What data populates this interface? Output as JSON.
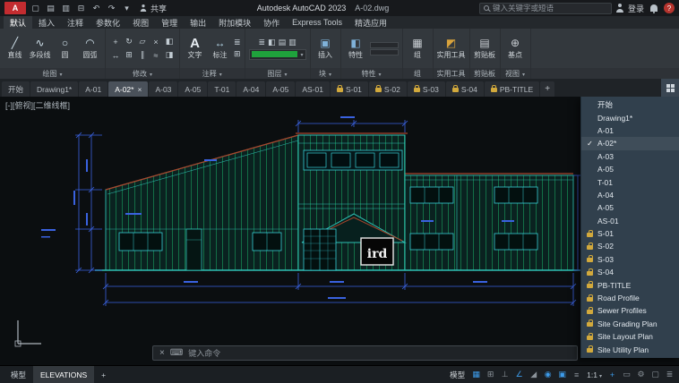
{
  "titlebar": {
    "logo_text": "A",
    "quick_icons": [
      {
        "glyph": "▢",
        "name": "new-drawing-icon"
      },
      {
        "glyph": "▤",
        "name": "open-icon"
      },
      {
        "glyph": "▥",
        "name": "save-icon"
      },
      {
        "glyph": "⊟",
        "name": "plot-icon"
      },
      {
        "glyph": "↶",
        "name": "undo-icon"
      },
      {
        "glyph": "↷",
        "name": "redo-icon"
      },
      {
        "glyph": "▾",
        "name": "quick-access-dropdown-icon"
      }
    ],
    "share_label": "共享",
    "app_title": "Autodesk AutoCAD 2023",
    "doc_name": "A-02.dwg",
    "search_placeholder": "键入关键字或短语",
    "signin_label": "登录"
  },
  "ribbon": {
    "tabs": [
      {
        "label": "默认",
        "active": true
      },
      {
        "label": "插入"
      },
      {
        "label": "注释"
      },
      {
        "label": "参数化"
      },
      {
        "label": "视图"
      },
      {
        "label": "管理"
      },
      {
        "label": "输出"
      },
      {
        "label": "附加模块"
      },
      {
        "label": "协作"
      },
      {
        "label": "Express Tools"
      },
      {
        "label": "精选应用"
      }
    ],
    "draw": {
      "panel": "绘图",
      "tools": [
        {
          "glyph": "╱",
          "label": "直线",
          "name": "line-tool"
        },
        {
          "glyph": "∿",
          "label": "多段线",
          "name": "polyline-tool"
        },
        {
          "glyph": "○",
          "label": "圆",
          "name": "circle-tool"
        },
        {
          "glyph": "◠",
          "label": "圆弧",
          "name": "arc-tool"
        }
      ]
    },
    "modify": {
      "panel": "修改",
      "tools": [
        {
          "glyph": "+",
          "name": "move-tool"
        },
        {
          "glyph": "↻",
          "name": "rotate-tool"
        },
        {
          "glyph": "▱",
          "name": "stretch-tool"
        },
        {
          "glyph": "×",
          "name": "erase-tool"
        },
        {
          "glyph": "◧",
          "name": "mirror-tool"
        },
        {
          "glyph": "↔",
          "name": "offset-tool"
        },
        {
          "glyph": "⊞",
          "name": "array-tool"
        },
        {
          "glyph": "∥",
          "name": "fillet-tool"
        },
        {
          "glyph": "≈",
          "name": "chamfer-tool"
        },
        {
          "glyph": "◨",
          "name": "trim-tool"
        }
      ]
    },
    "annotation": {
      "panel": "注释",
      "text_glyph": "A",
      "text_label": "文字",
      "dim_glyph": "↔",
      "dim_label": "标注",
      "small_icons": [
        {
          "glyph": "≣",
          "name": "leader-tool"
        },
        {
          "glyph": "⊞",
          "name": "table-tool"
        }
      ]
    },
    "layers": {
      "panel": "图层",
      "icons": [
        {
          "glyph": "≣",
          "name": "layer-properties-icon"
        },
        {
          "glyph": "◧",
          "name": "layer-state-icon"
        },
        {
          "glyph": "▤",
          "name": "layer-isolate-icon"
        },
        {
          "glyph": "▥",
          "name": "layer-freeze-icon"
        }
      ]
    },
    "block": {
      "panel": "块",
      "insert_glyph": "▣",
      "insert_label": "插入"
    },
    "properties": {
      "panel": "特性",
      "glyph": "◧",
      "label": "特性"
    },
    "groups": {
      "panel": "组",
      "glyph": "▦",
      "label": "组"
    },
    "utilities": {
      "panel": "实用工具",
      "glyph": "◩",
      "label": "实用工具"
    },
    "clipboard": {
      "panel": "剪贴板",
      "glyph": "▤",
      "label": "剪贴板"
    },
    "view": {
      "panel": "视图",
      "base_glyph": "⊕",
      "base_label": "基点"
    }
  },
  "file_tab_bar": {
    "new_tab_label": "+"
  },
  "file_tabs": [
    {
      "label": "开始"
    },
    {
      "label": "Drawing1*"
    },
    {
      "label": "A-01"
    },
    {
      "label": "A-02*",
      "active": true,
      "closable": true
    },
    {
      "label": "A-03"
    },
    {
      "label": "A-05"
    },
    {
      "label": "T-01"
    },
    {
      "label": "A-04"
    },
    {
      "label": "A-05"
    },
    {
      "label": "AS-01"
    },
    {
      "label": "S-01",
      "locked": true
    },
    {
      "label": "S-02",
      "locked": true
    },
    {
      "label": "S-03",
      "locked": true
    },
    {
      "label": "S-04",
      "locked": true
    },
    {
      "label": "PB-TITLE",
      "locked": true
    }
  ],
  "canvas": {
    "viewport_label": "[-][俯视][二维线框]",
    "sign_text": "ird"
  },
  "command_bar": {
    "prompt": "键入命令",
    "kb_glyph": "⌨"
  },
  "tab_menu": {
    "items": [
      {
        "label": "开始"
      },
      {
        "label": "Drawing1*"
      },
      {
        "label": "A-01"
      },
      {
        "label": "A-02*",
        "checked": true
      },
      {
        "label": "A-03"
      },
      {
        "label": "A-05"
      },
      {
        "label": "T-01"
      },
      {
        "label": "A-04"
      },
      {
        "label": "A-05"
      },
      {
        "label": "AS-01"
      },
      {
        "label": "S-01",
        "locked": true
      },
      {
        "label": "S-02",
        "locked": true
      },
      {
        "label": "S-03",
        "locked": true
      },
      {
        "label": "S-04",
        "locked": true
      },
      {
        "label": "PB-TITLE",
        "locked": true
      },
      {
        "label": "Road Profile",
        "locked": true
      },
      {
        "label": "Sewer Profiles",
        "locked": true
      },
      {
        "label": "Site Grading Plan",
        "locked": true
      },
      {
        "label": "Site Layout Plan",
        "locked": true
      },
      {
        "label": "Site Utility Plan",
        "locked": true
      }
    ]
  },
  "statusbar": {
    "model_tab": "模型",
    "layout_tab": "ELEVATIONS",
    "add_layout": "+",
    "model_button": "模型",
    "scale": "1:1",
    "icons_left": [
      {
        "glyph": "▦",
        "name": "grid-display-toggle",
        "on": true
      },
      {
        "glyph": "⊞",
        "name": "snap-mode-toggle"
      },
      {
        "glyph": "⊥",
        "name": "ortho-mode-toggle"
      },
      {
        "glyph": "∠",
        "name": "polar-tracking-toggle",
        "on": true
      },
      {
        "glyph": "◢",
        "name": "isometric-drafting-toggle"
      },
      {
        "glyph": "◉",
        "name": "object-snap-tracking-toggle",
        "on": true
      },
      {
        "glyph": "▣",
        "name": "object-snap-toggle",
        "on": true
      },
      {
        "glyph": "≡",
        "name": "lineweight-toggle"
      }
    ],
    "icons_right": [
      {
        "glyph": "+",
        "name": "annotation-visibility-toggle",
        "on": true
      },
      {
        "glyph": "▭",
        "name": "autoscale-toggle"
      },
      {
        "glyph": "⚙",
        "name": "workspace-switching-button"
      },
      {
        "glyph": "▢",
        "name": "isolate-objects-button"
      },
      {
        "glyph": "≣",
        "name": "customization-button"
      }
    ]
  },
  "colors": {
    "logo_red": "#c32c30",
    "dimension_blue": "#3a62e0",
    "wall_teal": "#2aaea2",
    "siding_green": "#15824f",
    "window_cyan": "#38cfd6",
    "roof_accent_red": "#a8462c",
    "lock_gold": "#d2a93c",
    "active_icon_blue": "#3d9be9",
    "layer_swatch_green": "#1fa23c"
  }
}
